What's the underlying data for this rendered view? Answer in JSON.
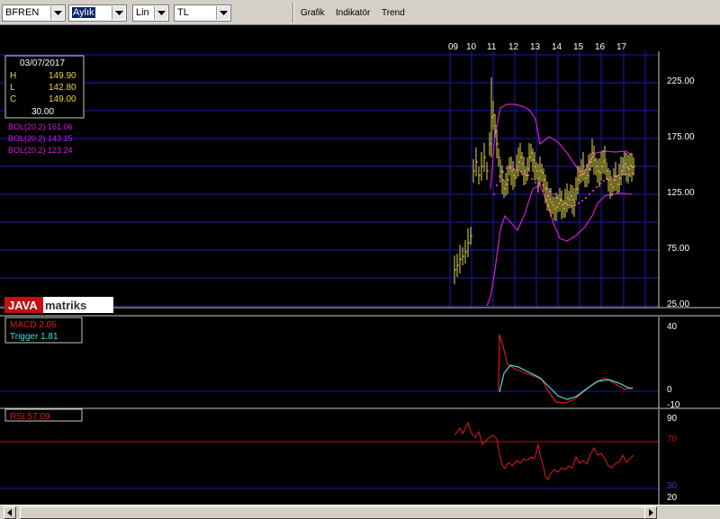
{
  "toolbar": {
    "symbol": "BFREN",
    "period": "Aylık",
    "scale": "Lin",
    "currency": "TL",
    "menus": [
      "Grafik",
      "Indikatör",
      "Trend"
    ]
  },
  "price_panel": {
    "x_ticks": [
      "09",
      "10",
      "11",
      "12",
      "13",
      "14",
      "15",
      "16",
      "17"
    ],
    "y_ticks": [
      "225.00",
      "175.00",
      "125.00",
      "75.00",
      "25.00"
    ],
    "info_date": "03/07/2017",
    "info_h_label": "H",
    "info_h": "149.90",
    "info_l_label": "L",
    "info_l": "142.80",
    "info_c_label": "C",
    "info_c": "149.00",
    "info_vol": "30.00",
    "bol_upper": "BOL(20,2) 161.06",
    "bol_mid": "BOL(20,2) 143.15",
    "bol_lower": "BOL(20,2) 123.24",
    "logo_left": "JAVA",
    "logo_right": "matriks"
  },
  "macd_panel": {
    "macd_label": "MACD 2.06",
    "trigger_label": "Trigger 1.81",
    "y_ticks": [
      "40",
      "0",
      "-10"
    ]
  },
  "rsi_panel": {
    "rsi_label": "RSI 57.09",
    "y_ticks": [
      "90",
      "70",
      "30",
      "20"
    ]
  },
  "colors": {
    "price": "#e6d84a",
    "bollinger": "#d21ed2",
    "macd": "#e01a1a",
    "trigger": "#40e0e0",
    "rsi": "#e01a1a",
    "grid": "#1c1ca8"
  }
}
